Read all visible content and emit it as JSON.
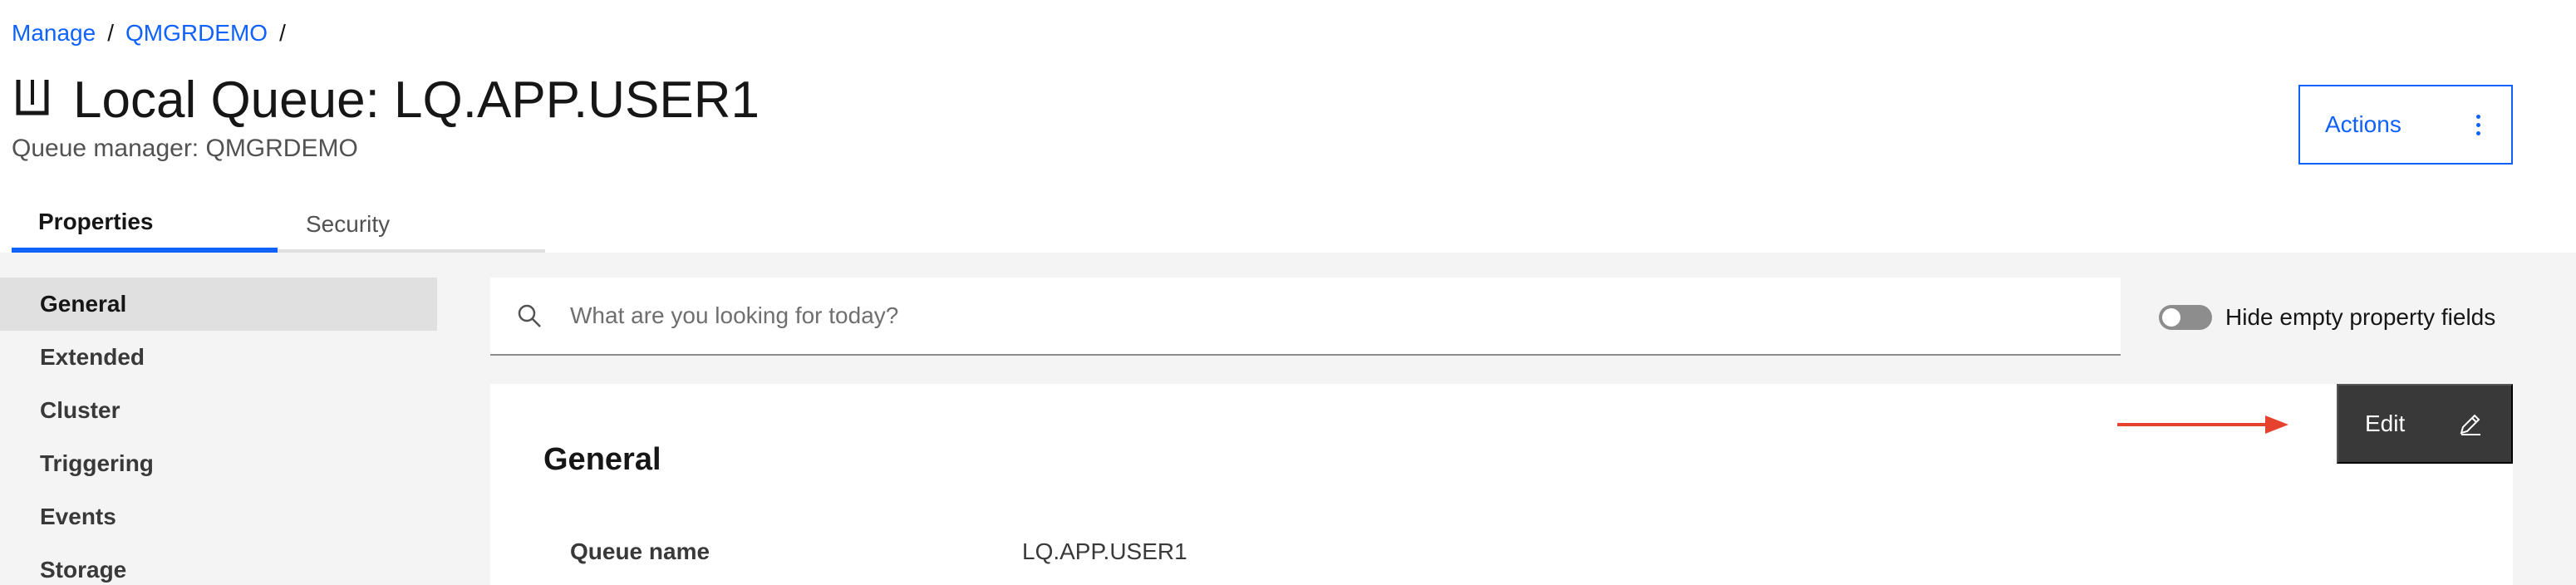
{
  "breadcrumb": {
    "items": [
      "Manage",
      "QMGRDEMO"
    ],
    "separator": "/"
  },
  "header": {
    "icon": "queue-icon",
    "title": "Local Queue: LQ.APP.USER1",
    "subtitle": "Queue manager: QMGRDEMO",
    "actions_label": "Actions"
  },
  "tabs": [
    {
      "label": "Properties",
      "active": true
    },
    {
      "label": "Security",
      "active": false
    }
  ],
  "sidebar": {
    "items": [
      {
        "label": "General",
        "active": true
      },
      {
        "label": "Extended",
        "active": false
      },
      {
        "label": "Cluster",
        "active": false
      },
      {
        "label": "Triggering",
        "active": false
      },
      {
        "label": "Events",
        "active": false
      },
      {
        "label": "Storage",
        "active": false
      }
    ]
  },
  "search": {
    "placeholder": "What are you looking for today?",
    "value": ""
  },
  "toggle": {
    "label": "Hide empty property fields",
    "on": false
  },
  "general_section": {
    "title": "General",
    "edit_label": "Edit",
    "properties": [
      {
        "label": "Queue name",
        "value": "LQ.APP.USER1"
      }
    ]
  },
  "colors": {
    "accent": "#0f62fe",
    "annotation_arrow": "#e5432d",
    "edit_button_bg": "#393939",
    "panel_bg": "#f4f4f4"
  }
}
